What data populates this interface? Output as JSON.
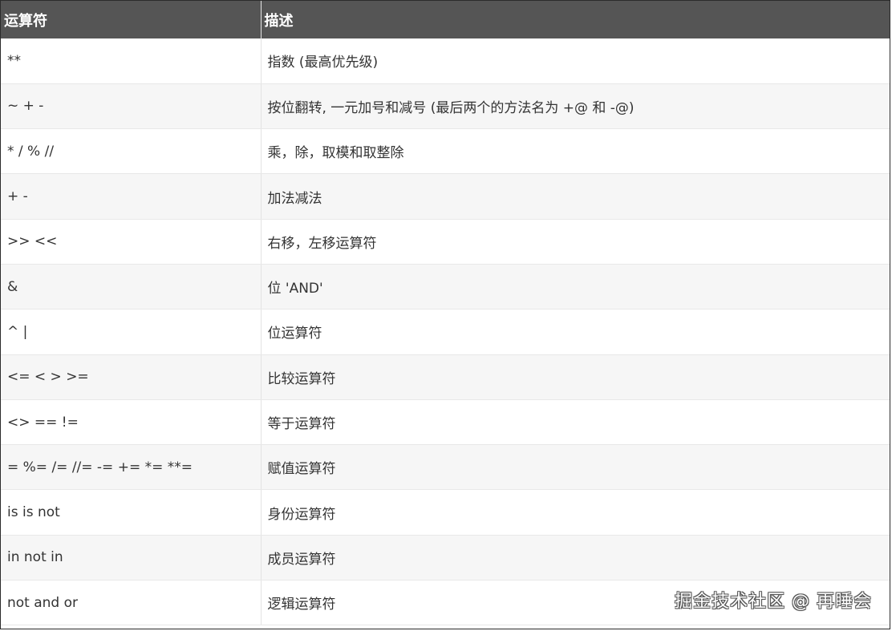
{
  "table": {
    "headers": [
      "运算符",
      "描述"
    ],
    "rows": [
      {
        "operator": "**",
        "description": "指数 (最高优先级)"
      },
      {
        "operator": "~ + -",
        "description": "按位翻转, 一元加号和减号 (最后两个的方法名为 +@ 和 -@)"
      },
      {
        "operator": "* / % //",
        "description": "乘，除，取模和取整除"
      },
      {
        "operator": "+ -",
        "description": "加法减法"
      },
      {
        "operator": ">> <<",
        "description": "右移，左移运算符"
      },
      {
        "operator": "&",
        "description": "位 'AND'"
      },
      {
        "operator": "^ |",
        "description": "位运算符"
      },
      {
        "operator": "<= < > >=",
        "description": "比较运算符"
      },
      {
        "operator": "<> == !=",
        "description": "等于运算符"
      },
      {
        "operator": "= %= /= //= -= += *= **=",
        "description": "赋值运算符"
      },
      {
        "operator": "is is not",
        "description": "身份运算符"
      },
      {
        "operator": "in not in",
        "description": "成员运算符"
      },
      {
        "operator": "not and or",
        "description": "逻辑运算符"
      }
    ]
  },
  "watermark": "掘金技术社区 @ 再睡会",
  "colors": {
    "header_bg": "#555555",
    "header_text": "#ffffff",
    "row_alt_bg": "#f6f6f6",
    "text": "#333333"
  }
}
